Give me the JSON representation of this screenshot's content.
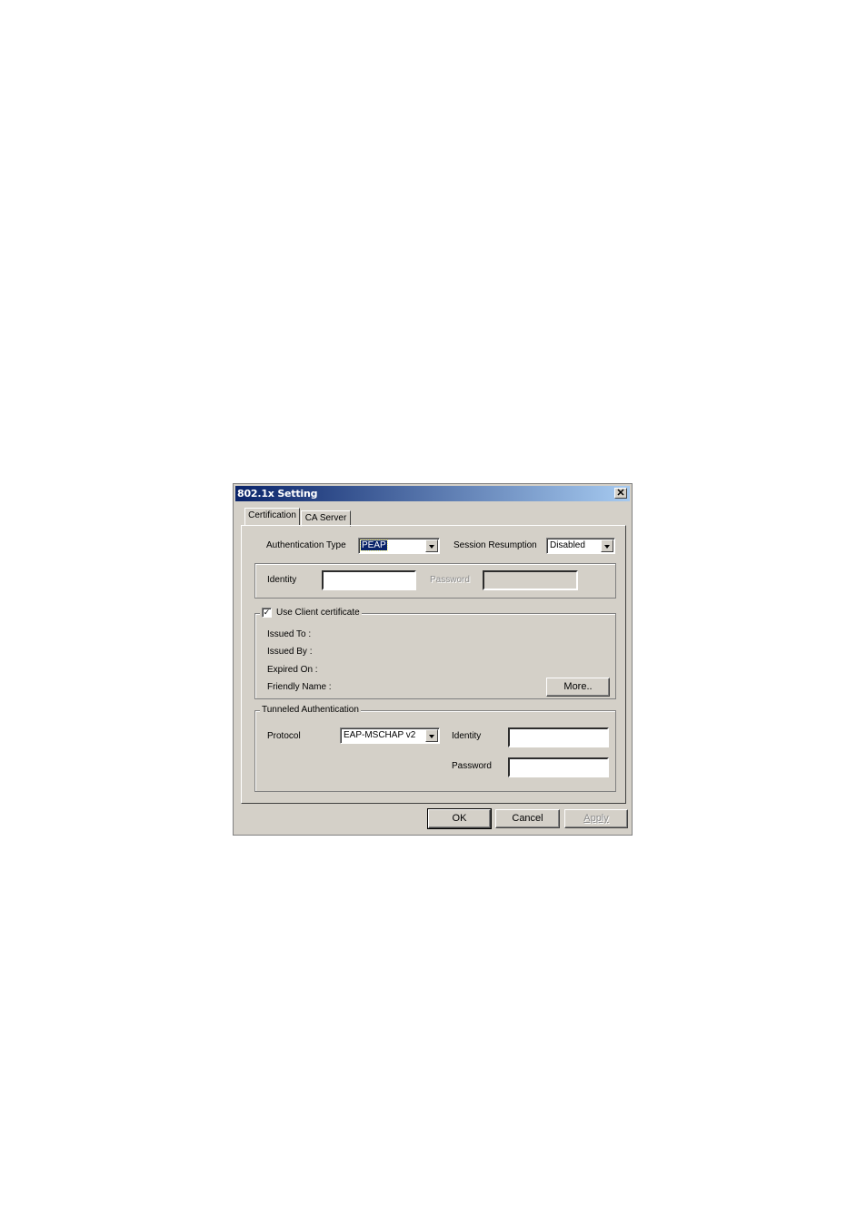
{
  "window": {
    "title": "802.1x Setting",
    "close_glyph": "✕"
  },
  "tabs": [
    {
      "label": "Certification",
      "active": true
    },
    {
      "label": "CA Server",
      "active": false
    }
  ],
  "auth": {
    "type_label": "Authentication Type",
    "type_value": "PEAP",
    "session_label": "Session Resumption",
    "session_value": "Disabled"
  },
  "identity_group": {
    "identity_label": "Identity",
    "identity_value": "",
    "password_label": "Password",
    "password_value": ""
  },
  "client_cert": {
    "checkbox_label": "Use Client certificate",
    "checked": true,
    "check_glyph": "✓",
    "issued_to": "Issued To :",
    "issued_by": "Issued By :",
    "expired_on": "Expired On :",
    "friendly_name": "Friendly Name :",
    "more_button": "More.."
  },
  "tunneled": {
    "legend": "Tunneled Authentication",
    "protocol_label": "Protocol",
    "protocol_value": "EAP-MSCHAP v2",
    "identity_label": "Identity",
    "identity_value": "",
    "password_label": "Password",
    "password_value": ""
  },
  "buttons": {
    "ok": "OK",
    "cancel": "Cancel",
    "apply": "Apply"
  },
  "colors": {
    "titlebar_start": "#0a246a",
    "titlebar_end": "#a6caf0",
    "dialog_face": "#d4d0c8"
  }
}
